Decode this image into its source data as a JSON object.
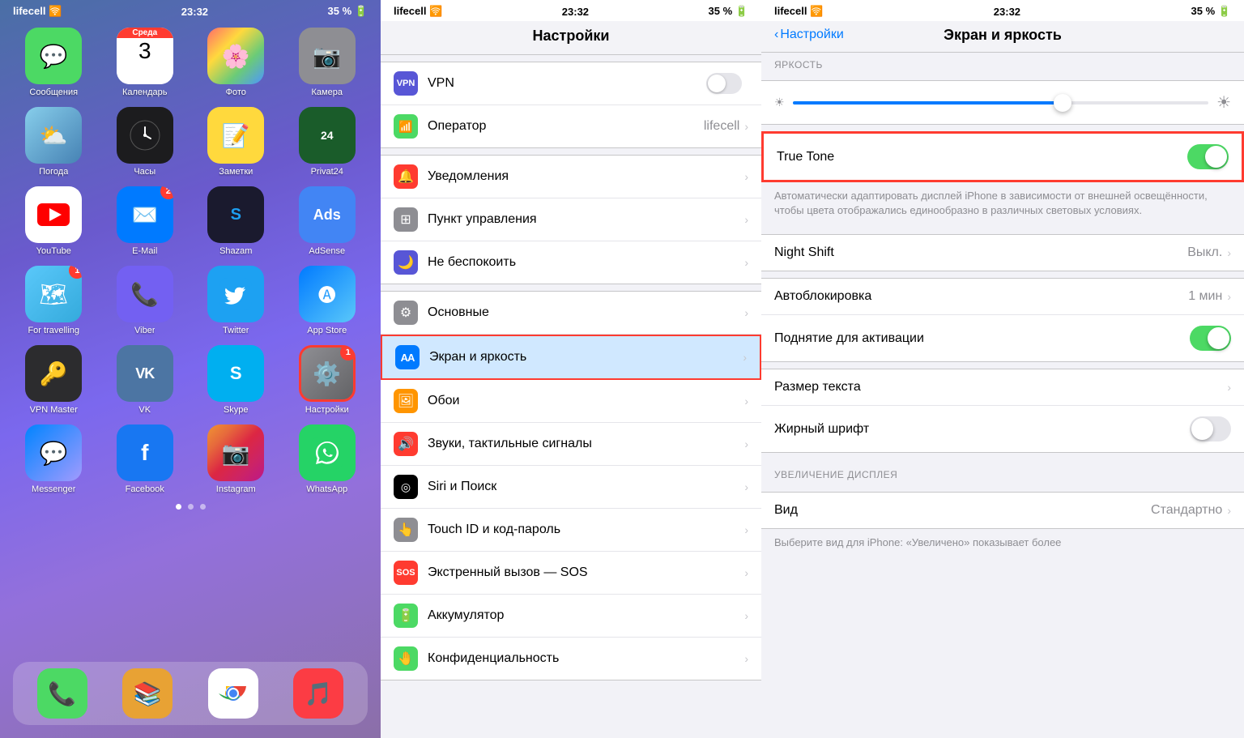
{
  "panel1": {
    "status": {
      "carrier": "lifecell",
      "signal": "📶",
      "wifi": "🛜",
      "time": "23:32",
      "battery": "35 %"
    },
    "apps": [
      {
        "id": "messages",
        "label": "Сообщения",
        "color": "app-messages",
        "icon": "💬",
        "badge": null
      },
      {
        "id": "calendar",
        "label": "Календарь",
        "color": "app-calendar",
        "icon": "calendar",
        "badge": null,
        "day": "3",
        "dayname": "Среда"
      },
      {
        "id": "photos",
        "label": "Фото",
        "color": "app-photos",
        "icon": "📷",
        "badge": null
      },
      {
        "id": "camera",
        "label": "Камера",
        "color": "app-camera",
        "icon": "📷",
        "badge": null
      },
      {
        "id": "weather",
        "label": "Погода",
        "color": "app-weather",
        "icon": "⛅",
        "badge": null
      },
      {
        "id": "clock",
        "label": "Часы",
        "color": "app-clock",
        "icon": "🕐",
        "badge": null
      },
      {
        "id": "notes",
        "label": "Заметки",
        "color": "app-notes",
        "icon": "📝",
        "badge": null
      },
      {
        "id": "privat24",
        "label": "Privat24",
        "color": "app-privat",
        "icon": "🏦",
        "badge": null
      },
      {
        "id": "youtube",
        "label": "YouTube",
        "color": "app-youtube",
        "icon": "▶",
        "badge": null
      },
      {
        "id": "email",
        "label": "E-Mail",
        "color": "app-email",
        "icon": "✉",
        "badge": "2"
      },
      {
        "id": "shazam",
        "label": "Shazam",
        "color": "app-shazam",
        "icon": "🎵",
        "badge": null
      },
      {
        "id": "adsense",
        "label": "AdSense",
        "color": "app-adsense",
        "icon": "₳",
        "badge": null
      },
      {
        "id": "maps",
        "label": "For travelling",
        "color": "app-maps",
        "icon": "🗺",
        "badge": "1"
      },
      {
        "id": "viber",
        "label": "Viber",
        "color": "app-viber",
        "icon": "📞",
        "badge": null
      },
      {
        "id": "twitter",
        "label": "Twitter",
        "color": "app-twitter",
        "icon": "🐦",
        "badge": null
      },
      {
        "id": "appstore",
        "label": "App Store",
        "color": "app-appstore",
        "icon": "🅐",
        "badge": null
      },
      {
        "id": "vpnmaster",
        "label": "VPN Master",
        "color": "app-vpnmaster",
        "icon": "🔑",
        "badge": null
      },
      {
        "id": "vk",
        "label": "VK",
        "color": "app-vk",
        "icon": "VK",
        "badge": null
      },
      {
        "id": "skype",
        "label": "Skype",
        "color": "app-skype",
        "icon": "S",
        "badge": null
      },
      {
        "id": "settings",
        "label": "Настройки",
        "color": "app-settings",
        "icon": "⚙",
        "badge": "1"
      },
      {
        "id": "messenger",
        "label": "Messenger",
        "color": "app-messenger",
        "icon": "💬",
        "badge": null
      },
      {
        "id": "facebook",
        "label": "Facebook",
        "color": "app-facebook",
        "icon": "f",
        "badge": null
      },
      {
        "id": "instagram",
        "label": "Instagram",
        "color": "app-instagram",
        "icon": "📷",
        "badge": null
      },
      {
        "id": "whatsapp",
        "label": "WhatsApp",
        "color": "app-whatsapp",
        "icon": "📱",
        "badge": null
      }
    ],
    "dock": [
      {
        "id": "phone",
        "label": "Phone",
        "color": "app-phone",
        "icon": "📞"
      },
      {
        "id": "books",
        "label": "Books",
        "color": "app-books",
        "icon": "📚"
      },
      {
        "id": "chrome",
        "label": "Chrome",
        "color": "app-chrome",
        "icon": "🌐"
      },
      {
        "id": "music",
        "label": "Music",
        "color": "app-music",
        "icon": "🎵"
      }
    ],
    "calendar_day": "3",
    "calendar_weekday": "Среда"
  },
  "panel2": {
    "status": {
      "carrier": "lifecell",
      "time": "23:32",
      "battery": "35 %"
    },
    "title": "Настройки",
    "rows": [
      {
        "id": "vpn",
        "label": "VPN",
        "icon_bg": "#5856d6",
        "icon_text": "VPN",
        "value": "",
        "type": "toggle",
        "icon_color": "white"
      },
      {
        "id": "operator",
        "label": "Оператор",
        "icon_bg": "#4cd964",
        "icon_text": "📶",
        "value": "lifecell",
        "type": "arrow"
      },
      {
        "id": "notifications",
        "label": "Уведомления",
        "icon_bg": "#ff3b30",
        "icon_text": "🔔",
        "value": "",
        "type": "arrow"
      },
      {
        "id": "control",
        "label": "Пункт управления",
        "icon_bg": "#8e8e93",
        "icon_text": "⊞",
        "value": "",
        "type": "arrow"
      },
      {
        "id": "donotdisturb",
        "label": "Не беспокоить",
        "icon_bg": "#5856d6",
        "icon_text": "🌙",
        "value": "",
        "type": "arrow"
      },
      {
        "id": "general",
        "label": "Основные",
        "icon_bg": "#8e8e93",
        "icon_text": "⚙",
        "value": "",
        "type": "arrow"
      },
      {
        "id": "display",
        "label": "Экран и яркость",
        "icon_bg": "#007aff",
        "icon_text": "AA",
        "value": "",
        "type": "arrow",
        "highlighted": true
      },
      {
        "id": "wallpaper",
        "label": "Обои",
        "icon_bg": "#ff9500",
        "icon_text": "🖼",
        "value": "",
        "type": "arrow"
      },
      {
        "id": "sounds",
        "label": "Звуки, тактильные сигналы",
        "icon_bg": "#ff3b30",
        "icon_text": "🔊",
        "value": "",
        "type": "arrow"
      },
      {
        "id": "siri",
        "label": "Siri и Поиск",
        "icon_bg": "#000",
        "icon_text": "◎",
        "value": "",
        "type": "arrow"
      },
      {
        "id": "touchid",
        "label": "Touch ID и код-пароль",
        "icon_bg": "#8e8e93",
        "icon_text": "👆",
        "value": "",
        "type": "arrow"
      },
      {
        "id": "sos",
        "label": "Экстренный вызов — SOS",
        "icon_bg": "#ff3b30",
        "icon_text": "SOS",
        "value": "",
        "type": "arrow"
      },
      {
        "id": "battery",
        "label": "Аккумулятор",
        "icon_bg": "#4cd964",
        "icon_text": "🔋",
        "value": "",
        "type": "arrow"
      },
      {
        "id": "privacy",
        "label": "Конфиденциальность",
        "icon_bg": "#4cd964",
        "icon_text": "🤚",
        "value": "",
        "type": "arrow"
      }
    ]
  },
  "panel3": {
    "status": {
      "carrier": "lifecell",
      "time": "23:32",
      "battery": "35 %"
    },
    "back_label": "Настройки",
    "title": "Экран и яркость",
    "brightness_section": "ЯРКОСТЬ",
    "true_tone_label": "True Tone",
    "true_tone_on": true,
    "true_tone_desc": "Автоматически адаптировать дисплей iPhone в зависимости от внешней освещённости, чтобы цвета отображались единообразно в различных световых условиях.",
    "rows": [
      {
        "id": "night_shift",
        "label": "Night Shift",
        "value": "Выкл.",
        "type": "arrow"
      },
      {
        "id": "autolockd",
        "label": "Автоблокировка",
        "value": "1 мин",
        "type": "arrow"
      },
      {
        "id": "raise_to_wake",
        "label": "Поднятие для активации",
        "value": "",
        "type": "toggle",
        "on": true
      },
      {
        "id": "text_size",
        "label": "Размер текста",
        "value": "",
        "type": "arrow"
      },
      {
        "id": "bold_text",
        "label": "Жирный шрифт",
        "value": "",
        "type": "toggle",
        "on": false
      }
    ],
    "display_zoom_section": "УВЕЛИЧЕНИЕ ДИСПЛЕЯ",
    "view_label": "Вид",
    "view_value": "Стандартно",
    "view_sub": "Выберите вид для iPhone: «Увеличено» показывает более"
  }
}
